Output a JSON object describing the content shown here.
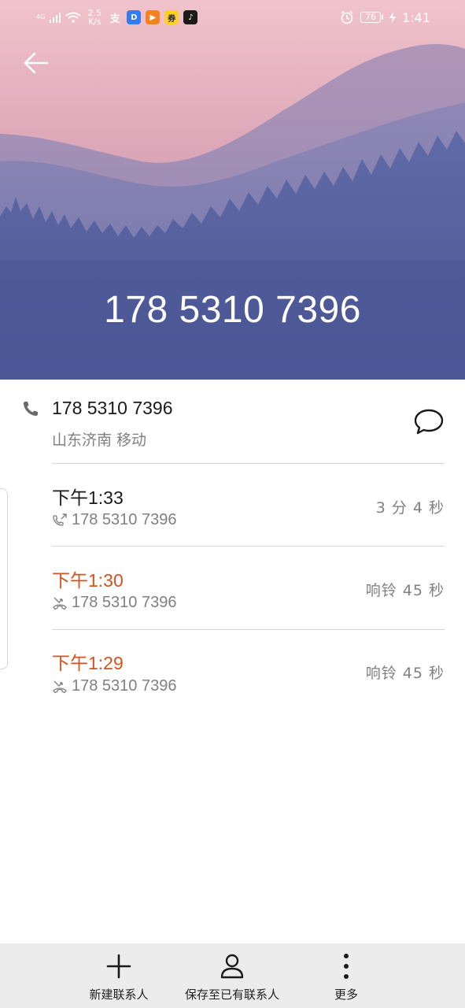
{
  "status_bar": {
    "network": "4G",
    "speed_value": "2.5",
    "speed_unit": "K/s",
    "battery": "76",
    "time": "1:41",
    "apps": [
      {
        "icon": "alipay-icon",
        "glyph": "支",
        "color": "#ffffff"
      },
      {
        "icon": "dingtalk-icon",
        "glyph": "D",
        "color": "#2f7cf6"
      },
      {
        "icon": "video-app-icon",
        "glyph": "▶",
        "color": "#f5821f"
      },
      {
        "icon": "shop-app-icon",
        "glyph": "券",
        "color": "#ffd21f"
      },
      {
        "icon": "tiktok-icon",
        "glyph": "♪",
        "color": "#1a1a1a"
      }
    ]
  },
  "header": {
    "back_icon": "arrow-left-icon",
    "phone_number": "178 5310 7396"
  },
  "contact": {
    "phone_number": "178 5310 7396",
    "location": "山东济南 移动",
    "phone_icon": "phone-icon",
    "message_icon": "message-bubble-icon"
  },
  "call_log": [
    {
      "time": "下午1:33",
      "number": "178 5310 7396",
      "duration": "3 分 4 秒",
      "type": "outgoing",
      "icon": "outgoing-call-icon"
    },
    {
      "time": "下午1:30",
      "number": "178 5310 7396",
      "duration": "响铃 45 秒",
      "type": "missed",
      "icon": "missed-call-icon"
    },
    {
      "time": "下午1:29",
      "number": "178 5310 7396",
      "duration": "响铃 45 秒",
      "type": "missed",
      "icon": "missed-call-icon"
    }
  ],
  "colors": {
    "missed": "#d2541e",
    "primary_text": "#1a1a1a",
    "secondary_text": "#808080",
    "bottom_bar": "#ececec"
  },
  "bottom_bar": {
    "new_contact": {
      "label": "新建联系人",
      "icon": "plus-icon"
    },
    "save_existing": {
      "label": "保存至已有联系人",
      "icon": "person-icon"
    },
    "more": {
      "label": "更多",
      "icon": "more-vertical-icon"
    }
  }
}
